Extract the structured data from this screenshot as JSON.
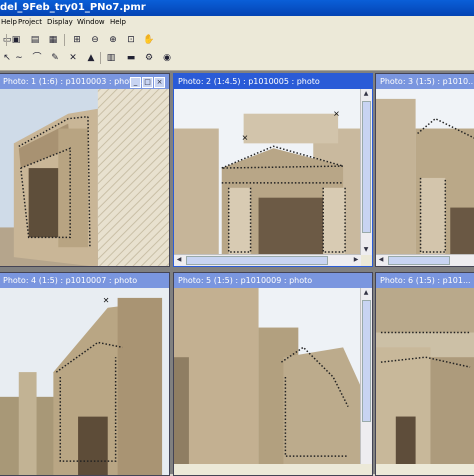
{
  "window": {
    "title": "del_9Feb_try01_PNo7.pmr"
  },
  "menu": [
    "Help",
    "Project",
    "Display",
    "Window",
    "Help"
  ],
  "toolbar_icons": [
    "open-icon",
    "photo-icon",
    "photo-list-icon",
    "select-icon",
    "draw-line-icon",
    "mark-point-icon",
    "edit-icon",
    "measure-icon",
    "zoom-fit-icon",
    "zoom-out-icon",
    "zoom-in-icon",
    "zoom-region-icon",
    "pan-icon",
    "tool-icon",
    "tool-icon-2",
    "table-icon",
    "ruler-icon",
    "grid-icon",
    "pointer-icon"
  ],
  "photos": [
    {
      "title": "Photo: 1 (1:6) : p1010003 : photo..."
    },
    {
      "title": "Photo: 2 (1:4.5) : p1010005 : photo"
    },
    {
      "title": "Photo: 3 (1:5) : p1010..."
    },
    {
      "title": "Photo: 4 (1:5) : p1010007 : photo"
    },
    {
      "title": "Photo: 5 (1:5) : p1010009 : photo"
    },
    {
      "title": "Photo: 6 (1:5) : p101..."
    }
  ],
  "colors": {
    "title_bar": "#0a5fd8",
    "caption_active": "#2a5bd7",
    "caption_inactive": "#7a96df",
    "marker": "#111111"
  }
}
